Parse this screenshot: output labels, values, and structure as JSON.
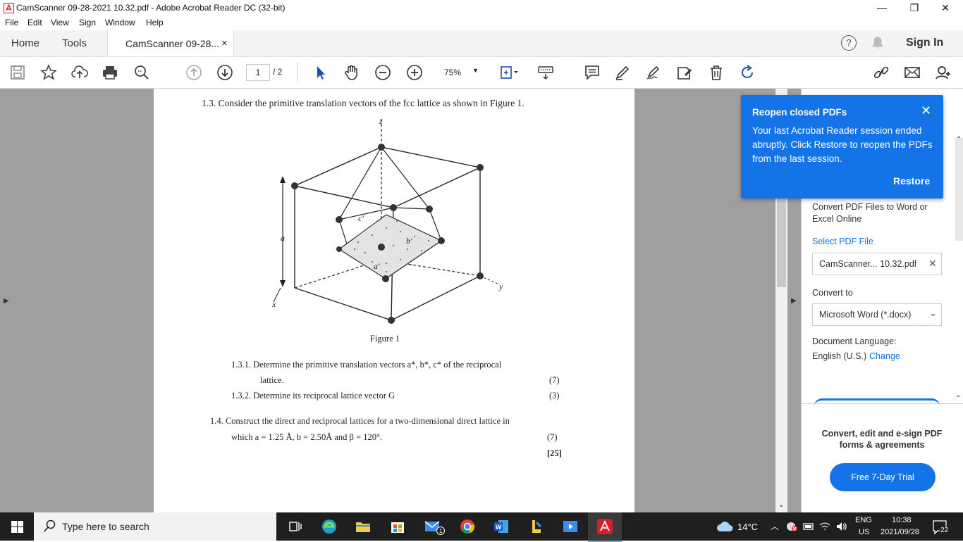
{
  "window": {
    "title": "CamScanner 09-28-2021 10.32.pdf - Adobe Acrobat Reader DC (32-bit)",
    "minimize": "—",
    "restore": "❐",
    "close": "✕"
  },
  "menu": [
    "File",
    "Edit",
    "View",
    "Sign",
    "Window",
    "Help"
  ],
  "tabs": {
    "home": "Home",
    "tools": "Tools",
    "document": "CamScanner 09-28...",
    "close": "×",
    "help": "?",
    "signin": "Sign In"
  },
  "toolbar": {
    "page_current": "1",
    "page_total": "/ 2",
    "zoom": "75%"
  },
  "document": {
    "q13": "1.3.   Consider the primitive translation vectors of the fcc lattice as shown in Figure 1.",
    "figure_caption": "Figure 1",
    "fig_labels": {
      "z": "z",
      "a": "a",
      "x": "x",
      "c": "c′",
      "b": "b′",
      "a2": "a′",
      "y": "y"
    },
    "q131": "1.3.1.   Determine  the  primitive  translation  vectors  a*, b*, c*  of  the  reciprocal",
    "q131b": "lattice.",
    "q131_marks": "(7)",
    "q132": "1.3.2.   Determine its reciprocal lattice vector G",
    "q132_marks": "(3)",
    "q14": "1.4.   Construct the direct and reciprocal lattices for a two-dimensional direct lattice in",
    "q14b": "which a = 1.25 Å, b = 2.50Å and β = 120°.",
    "q14_marks": "(7)",
    "total": "[25]"
  },
  "popup": {
    "title": "Reopen closed PDFs",
    "body": "Your last Acrobat Reader session ended abruptly. Click Restore to reopen the PDFs from the last session.",
    "restore": "Restore",
    "close": "✕"
  },
  "rightpane": {
    "convert_desc": "Convert PDF Files to Word or Excel Online",
    "select_file": "Select PDF File",
    "file_name": "CamScanner... 10.32.pdf",
    "convert_to_label": "Convert to",
    "convert_to_value": "Microsoft Word (*.docx)",
    "doc_lang_label": "Document Language:",
    "doc_lang_value": "English (U.S.)",
    "change": "Change",
    "promo": "Convert, edit and e-sign PDF forms & agreements",
    "trial": "Free 7-Day Trial"
  },
  "taskbar": {
    "search_placeholder": "Type here to search",
    "temperature": "14°C",
    "lang_top": "ENG",
    "lang_bottom": "US",
    "time": "10:38",
    "date": "2021/09/28",
    "notifications": "22"
  },
  "colors": {
    "accent": "#1473e6",
    "doc_bg": "#9f9f9f",
    "taskbar": "#1f1f1f"
  }
}
